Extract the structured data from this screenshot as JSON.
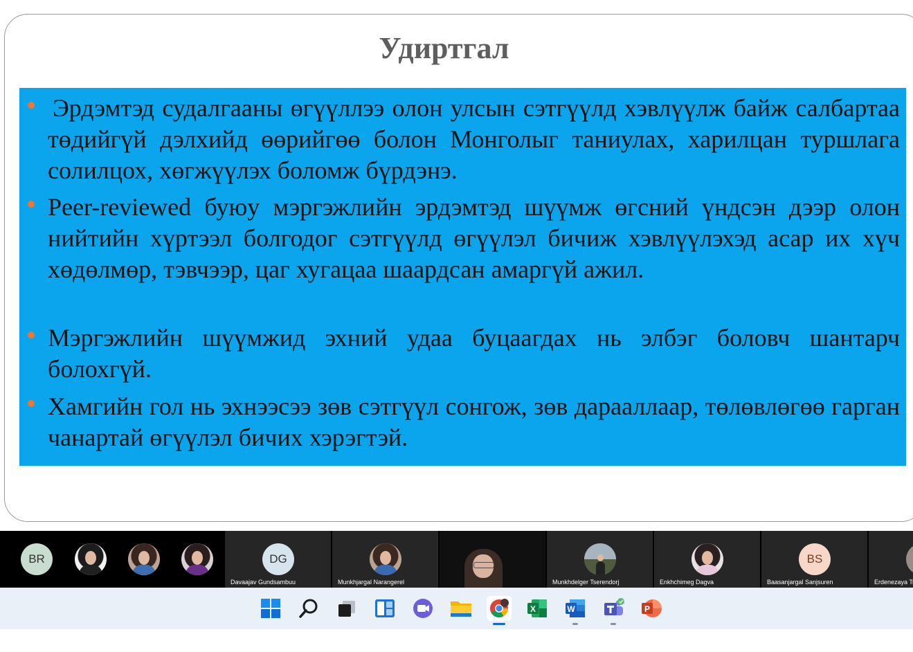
{
  "slide": {
    "title": "Удиртгал",
    "bullets": [
      "Эрдэмтэд судалгааны өгүүллээ олон улсын сэтгүүлд хэвлүүлж байж салбартаа төдийгүй дэлхийд өөрийгөө болон Монголыг таниулах, харилцан туршлага солилцох, хөгжүүлэх боломж бүрдэнэ.",
      "Peer-reviewed буюу мэргэжлийн эрдэмтэд шүүмж өгсний үндсэн дээр олон нийтийн хүртээл болгодог сэтгүүлд өгүүлэл бичиж хэвлүүлэхэд асар их хүч хөдөлмөр, тэвчээр, цаг хугацаа шаардсан амаргүй ажил.",
      "Мэргэжлийн шүүмжид эхний удаа буцаагдах нь элбэг боловч шантарч болохгүй.",
      "Хамгийн гол нь эхнээсээ зөв сэтгүүл сонгож, зөв дарааллаар, төлөвлөгөө гарган чанартай өгүүлэл бичих хэрэгтэй."
    ],
    "colors": {
      "box": "#0aa5ec",
      "bullet": "#ee7632",
      "title": "#5e5e5e"
    }
  },
  "participants": [
    {
      "initials": "BR",
      "name": "",
      "avatar_color": "#c8dcd0"
    },
    {
      "initials": "",
      "name": "",
      "photo": "woman-photo"
    },
    {
      "initials": "",
      "name": "",
      "photo": "woman-photo"
    },
    {
      "initials": "",
      "name": "",
      "photo": "woman-photo"
    },
    {
      "initials": "DG",
      "name": "Davaajav Gundsambuu",
      "avatar_color": "#d6e4ee"
    },
    {
      "initials": "",
      "name": "Munkhjargal Narangerel",
      "photo": "woman-photo"
    },
    {
      "initials": "",
      "name": "",
      "video": "active-speaker-video"
    },
    {
      "initials": "",
      "name": "Munkhdelger Tserendorj",
      "photo": "outdoor-photo"
    },
    {
      "initials": "",
      "name": "Enkhchimeg Dagva",
      "photo": "woman-photo"
    },
    {
      "initials": "BS",
      "name": "Baasanjargal Sanjsuren",
      "avatar_color": "#f6d7c8"
    },
    {
      "initials": "",
      "name": "Erdenezaya Ts",
      "photo": "woman-photo"
    }
  ],
  "taskbar": {
    "icons": [
      "windows-start-icon",
      "search-icon",
      "task-view-icon",
      "widgets-icon",
      "chat-icon",
      "file-explorer-icon",
      "chrome-icon",
      "excel-icon",
      "word-icon",
      "teams-icon",
      "powerpoint-icon"
    ],
    "excel_letter": "X",
    "word_letter": "W",
    "powerpoint_letter": "P"
  }
}
